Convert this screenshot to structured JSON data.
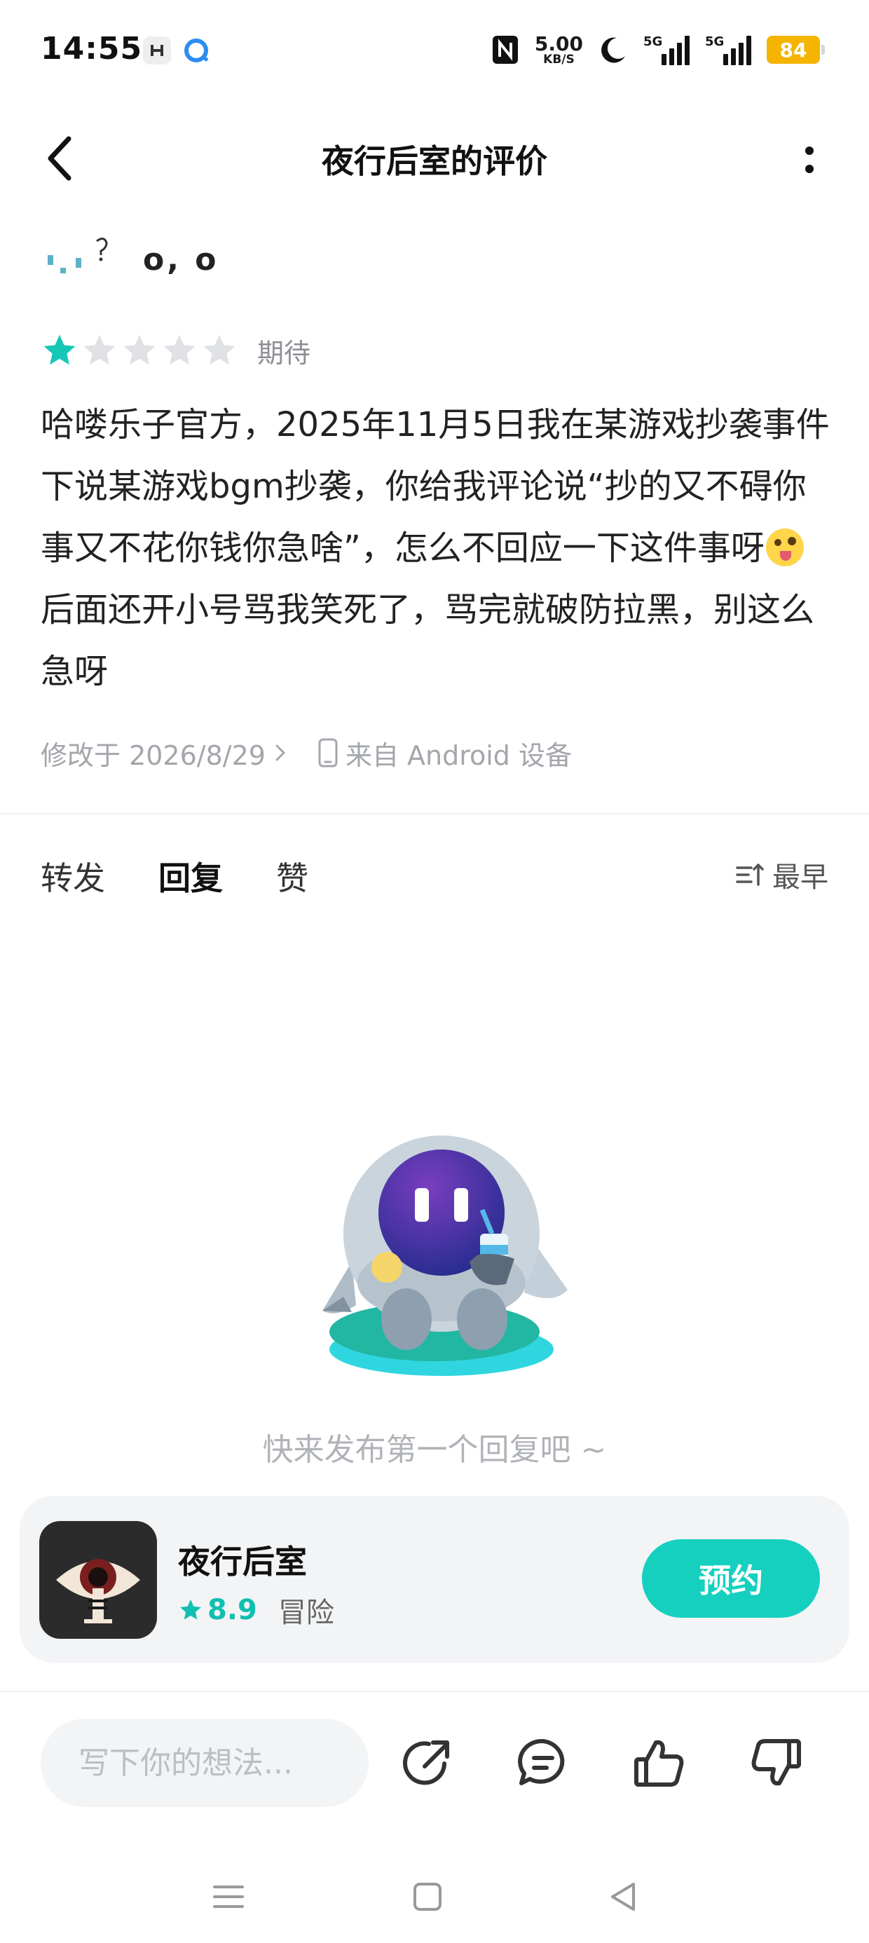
{
  "status_bar": {
    "time": "14:55",
    "net_speed_value": "5.00",
    "net_speed_unit": "KB/S",
    "signal1_label": "5G",
    "signal2_label": "5G",
    "battery": "84"
  },
  "header": {
    "title": "夜行后室的评价"
  },
  "review": {
    "username": "o, o",
    "rating": {
      "value": 1,
      "max": 5,
      "label": "期待"
    },
    "text_before_emoji": "哈喽乐子官方，2025年11月5日我在某游戏抄袭事件下说某游戏bgm抄袭，你给我评论说“抄的又不碍你事又不花你钱你急啥”，怎么不回应一下这件事呀",
    "text_after_emoji": "后面还开小号骂我笑死了，骂完就破防拉黑，别这么急呀",
    "modified": "修改于 2026/8/29",
    "device": "来自 Android 设备"
  },
  "tabs": [
    {
      "label": "转发",
      "active": false
    },
    {
      "label": "回复",
      "active": true
    },
    {
      "label": "赞",
      "active": false
    }
  ],
  "sort_label": "最早",
  "empty_state": {
    "text": "快来发布第一个回复吧 ~"
  },
  "game_card": {
    "name": "夜行后室",
    "score": "8.9",
    "genre": "冒险",
    "button": "预约"
  },
  "bottom_bar": {
    "input_placeholder": "写下你的想法..."
  },
  "colors": {
    "accent": "#16d0bf",
    "star_active": "#16c7b7",
    "star_inactive": "#dfe1e5",
    "battery": "#f5b400"
  }
}
